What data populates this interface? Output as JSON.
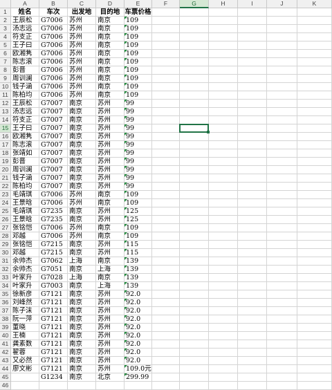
{
  "columns": [
    "A",
    "B",
    "C",
    "D",
    "E",
    "F",
    "G",
    "H",
    "I",
    "J",
    "K"
  ],
  "active_column": "G",
  "active_row": 15,
  "rows": [
    [
      "姓名",
      "车次",
      "出发地",
      "目的地",
      "车票价格"
    ],
    [
      "王辰松",
      "G7006",
      "苏州",
      "南京",
      "109"
    ],
    [
      "汤志远",
      "G7006",
      "苏州",
      "南京",
      "109"
    ],
    [
      "符支正",
      "G7006",
      "苏州",
      "南京",
      "109"
    ],
    [
      "王子曰",
      "G7006",
      "苏州",
      "南京",
      "109"
    ],
    [
      "欧湘隽",
      "G7006",
      "苏州",
      "南京",
      "109"
    ],
    [
      "陈志滚",
      "G7006",
      "苏州",
      "南京",
      "109"
    ],
    [
      "彭晋",
      "G7006",
      "苏州",
      "南京",
      "109"
    ],
    [
      "周训澜",
      "G7006",
      "苏州",
      "南京",
      "109"
    ],
    [
      "钱子涵",
      "G7006",
      "苏州",
      "南京",
      "109"
    ],
    [
      "陈柏均",
      "G7006",
      "苏州",
      "南京",
      "109"
    ],
    [
      "王辰松",
      "G7007",
      "南京",
      "苏州",
      "99"
    ],
    [
      "汤志远",
      "G7007",
      "南京",
      "苏州",
      "99"
    ],
    [
      "符支正",
      "G7007",
      "南京",
      "苏州",
      "99"
    ],
    [
      "王子曰",
      "G7007",
      "南京",
      "苏州",
      "99"
    ],
    [
      "欧湘隽",
      "G7007",
      "南京",
      "苏州",
      "99"
    ],
    [
      "陈志滚",
      "G7007",
      "南京",
      "苏州",
      "99"
    ],
    [
      "张靖如",
      "G7007",
      "南京",
      "苏州",
      "99"
    ],
    [
      "彭晋",
      "G7007",
      "南京",
      "苏州",
      "99"
    ],
    [
      "周训澜",
      "G7007",
      "南京",
      "苏州",
      "99"
    ],
    [
      "钱子涵",
      "G7007",
      "南京",
      "苏州",
      "99"
    ],
    [
      "陈柏均",
      "G7007",
      "南京",
      "苏州",
      "99"
    ],
    [
      "毛靖琪",
      "G7006",
      "苏州",
      "南京",
      "109"
    ],
    [
      "王景晗",
      "G7006",
      "苏州",
      "南京",
      "109"
    ],
    [
      "毛靖琪",
      "G7235",
      "南京",
      "苏州",
      "125"
    ],
    [
      "王景晗",
      "G7235",
      "南京",
      "苏州",
      "125"
    ],
    [
      "张铭恺",
      "G7006",
      "苏州",
      "南京",
      "109"
    ],
    [
      "邓越",
      "G7006",
      "苏州",
      "南京",
      "109"
    ],
    [
      "张铭恺",
      "G7215",
      "南京",
      "苏州",
      "115"
    ],
    [
      "邓越",
      "G7215",
      "南京",
      "苏州",
      "115"
    ],
    [
      "余帅杰",
      "G7062",
      "上海",
      "南京",
      "139"
    ],
    [
      "余帅杰",
      "G7051",
      "南京",
      "上海",
      "139"
    ],
    [
      "叶家升",
      "G7028",
      "上海",
      "南京",
      "139"
    ],
    [
      "叶家升",
      "G7003",
      "南京",
      "上海",
      "139"
    ],
    [
      "徐新彦",
      "G7121",
      "南京",
      "苏州",
      "92.0"
    ],
    [
      "刘峰然",
      "G7121",
      "南京",
      "苏州",
      "92.0"
    ],
    [
      "陈子沫",
      "G7121",
      "南京",
      "苏州",
      "92.0"
    ],
    [
      "阮一萍",
      "G7121",
      "南京",
      "苏州",
      "92.0"
    ],
    [
      "董晓",
      "G7121",
      "南京",
      "苏州",
      "92.0"
    ],
    [
      "王楠",
      "G7121",
      "南京",
      "苏州",
      "92.0"
    ],
    [
      "龚素数",
      "G7121",
      "南京",
      "苏州",
      "92.0"
    ],
    [
      "翟蓉",
      "G7121",
      "南京",
      "苏州",
      "92.0"
    ],
    [
      "又必然",
      "G7121",
      "南京",
      "苏州",
      "92.0"
    ],
    [
      "廖文彬",
      "G7121",
      "南京",
      "苏州",
      "109.0元"
    ],
    [
      "",
      "G1234",
      "南京",
      "北京",
      "299.99"
    ]
  ],
  "green_flag_rows_from": 2
}
